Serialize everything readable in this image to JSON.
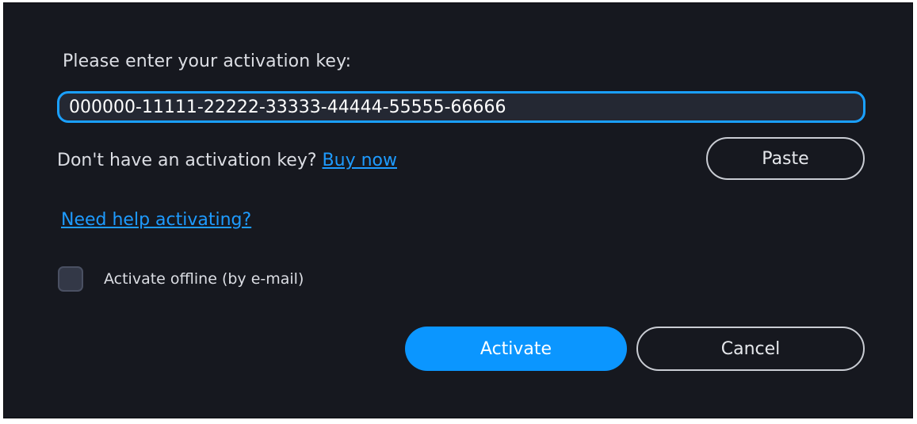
{
  "dialog": {
    "prompt": "Please enter your activation key:",
    "key_input": {
      "value": "000000-11111-22222-33333-44444-55555-66666"
    },
    "no_key_text": "Don't have an activation key?",
    "buy_now_link": "Buy now",
    "paste_button": "Paste",
    "help_link": "Need help activating?",
    "offline_checkbox": {
      "label": "Activate offline (by e-mail)",
      "checked": false
    },
    "activate_button": "Activate",
    "cancel_button": "Cancel"
  },
  "colors": {
    "background": "#16181f",
    "accent": "#0b96ff",
    "link": "#1e9bff",
    "input_border": "#1aa0ff"
  }
}
